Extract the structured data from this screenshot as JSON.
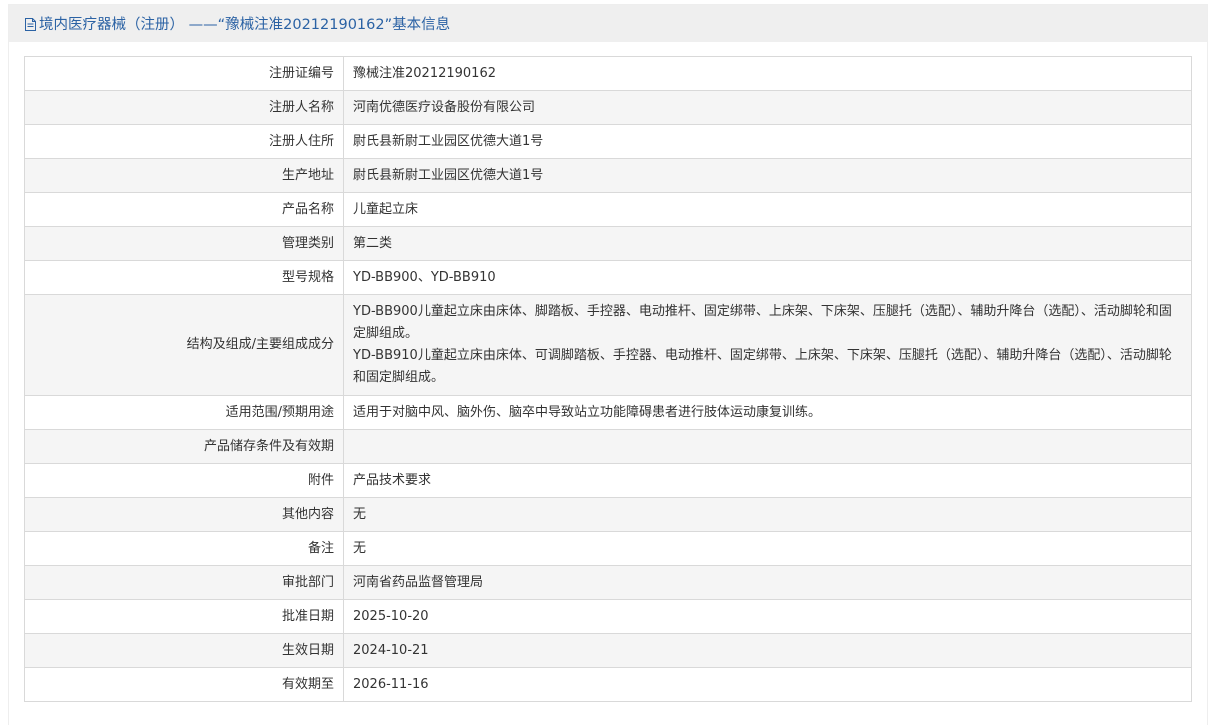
{
  "header": {
    "title": "境内医疗器械（注册） ——“豫械注准20212190162”基本信息"
  },
  "rows": [
    {
      "label": "注册证编号",
      "value": "豫械注准20212190162"
    },
    {
      "label": "注册人名称",
      "value": "河南优德医疗设备股份有限公司"
    },
    {
      "label": "注册人住所",
      "value": "尉氏县新尉工业园区优德大道1号"
    },
    {
      "label": "生产地址",
      "value": "尉氏县新尉工业园区优德大道1号"
    },
    {
      "label": "产品名称",
      "value": "儿童起立床"
    },
    {
      "label": "管理类别",
      "value": "第二类"
    },
    {
      "label": "型号规格",
      "value": "YD-BB900、YD-BB910"
    },
    {
      "label": "结构及组成/主要组成成分",
      "value_lines": [
        "YD-BB900儿童起立床由床体、脚踏板、手控器、电动推杆、固定绑带、上床架、下床架、压腿托（选配）、辅助升降台（选配）、活动脚轮和固定脚组成。",
        "YD-BB910儿童起立床由床体、可调脚踏板、手控器、电动推杆、固定绑带、上床架、下床架、压腿托（选配）、辅助升降台（选配）、活动脚轮和固定脚组成。"
      ]
    },
    {
      "label": "适用范围/预期用途",
      "value": "适用于对脑中风、脑外伤、脑卒中导致站立功能障碍患者进行肢体运动康复训练。"
    },
    {
      "label": "产品储存条件及有效期",
      "value": ""
    },
    {
      "label": "附件",
      "value": "产品技术要求"
    },
    {
      "label": "其他内容",
      "value": "无"
    },
    {
      "label": "备注",
      "value": "无"
    },
    {
      "label": "审批部门",
      "value": "河南省药品监督管理局"
    },
    {
      "label": "批准日期",
      "value": "2025-10-20"
    },
    {
      "label": "生效日期",
      "value": "2024-10-21"
    },
    {
      "label": "有效期至",
      "value": "2026-11-16"
    }
  ],
  "colors": {
    "header_text": "#2b62a4",
    "header_bg": "#efefef",
    "row_alt_bg": "#f5f5f5",
    "border": "#d9d9d9"
  },
  "icons": {
    "header_icon": "document-icon"
  }
}
